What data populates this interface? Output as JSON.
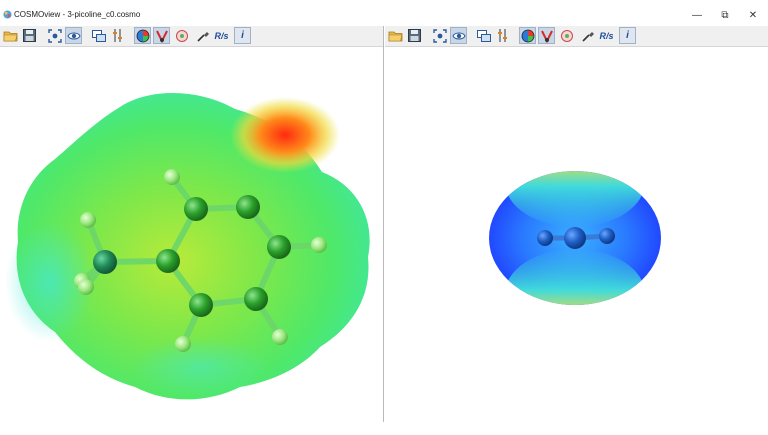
{
  "window": {
    "title": "COSMOview - 3-picoline_c0.cosmo",
    "controls": {
      "minimize": "—",
      "restore": "⧉",
      "close": "✕"
    }
  },
  "toolbar_items": [
    {
      "name": "open-folder-icon"
    },
    {
      "name": "save-icon"
    },
    {
      "name": "fit-view-icon"
    },
    {
      "name": "eye-view-icon",
      "active": true
    },
    {
      "name": "window-layout-icon"
    },
    {
      "name": "settings-tuning-icon"
    },
    {
      "name": "sigma-surface-icon",
      "active": true
    },
    {
      "name": "charge-color-icon",
      "active": true
    },
    {
      "name": "segment-surface-icon"
    },
    {
      "name": "pipette-icon"
    },
    {
      "name": "rs-label-icon",
      "text": "R/s"
    },
    {
      "name": "info-icon",
      "text": "i"
    }
  ],
  "panes": [
    {
      "name": "3-picoline molecule view"
    },
    {
      "name": "solvent molecule view"
    }
  ],
  "colors": {
    "surface_green": "#4ee86a",
    "surface_yellow": "#d8e83c",
    "surface_red": "#ff2a10",
    "surface_cyan": "#42e8d8",
    "surface_blue": "#1f4cff",
    "atom_green": "#2aa02a"
  }
}
